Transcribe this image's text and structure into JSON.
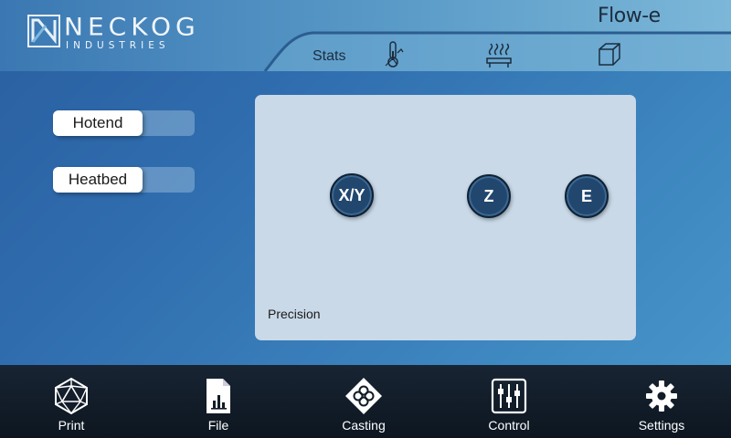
{
  "header": {
    "logo": {
      "name": "NECKOG",
      "sub": "INDUSTRIES"
    },
    "app_name": "Flow-e",
    "tabs": [
      {
        "label": "Stats",
        "icon": "stats-tab"
      },
      {
        "label": "",
        "icon": "thermometer-icon"
      },
      {
        "label": "",
        "icon": "heatbed-icon"
      },
      {
        "label": "",
        "icon": "cube-icon"
      }
    ]
  },
  "toggles": {
    "hotend": {
      "label": "Hotend",
      "state": "off"
    },
    "heatbed": {
      "label": "Heatbed",
      "state": "off"
    }
  },
  "panel": {
    "axes": [
      {
        "label": "X/Y"
      },
      {
        "label": "Z"
      },
      {
        "label": "E"
      }
    ],
    "precision_label": "Precision"
  },
  "nav": {
    "items": [
      {
        "label": "Print",
        "icon": "icosahedron-icon"
      },
      {
        "label": "File",
        "icon": "file-chart-icon"
      },
      {
        "label": "Casting",
        "icon": "casting-icon"
      },
      {
        "label": "Control",
        "icon": "sliders-icon"
      },
      {
        "label": "Settings",
        "icon": "gear-icon"
      }
    ]
  },
  "colors": {
    "navbar": "#121c28",
    "axis_button": "#21476e",
    "panel": "#c9d9e8"
  }
}
